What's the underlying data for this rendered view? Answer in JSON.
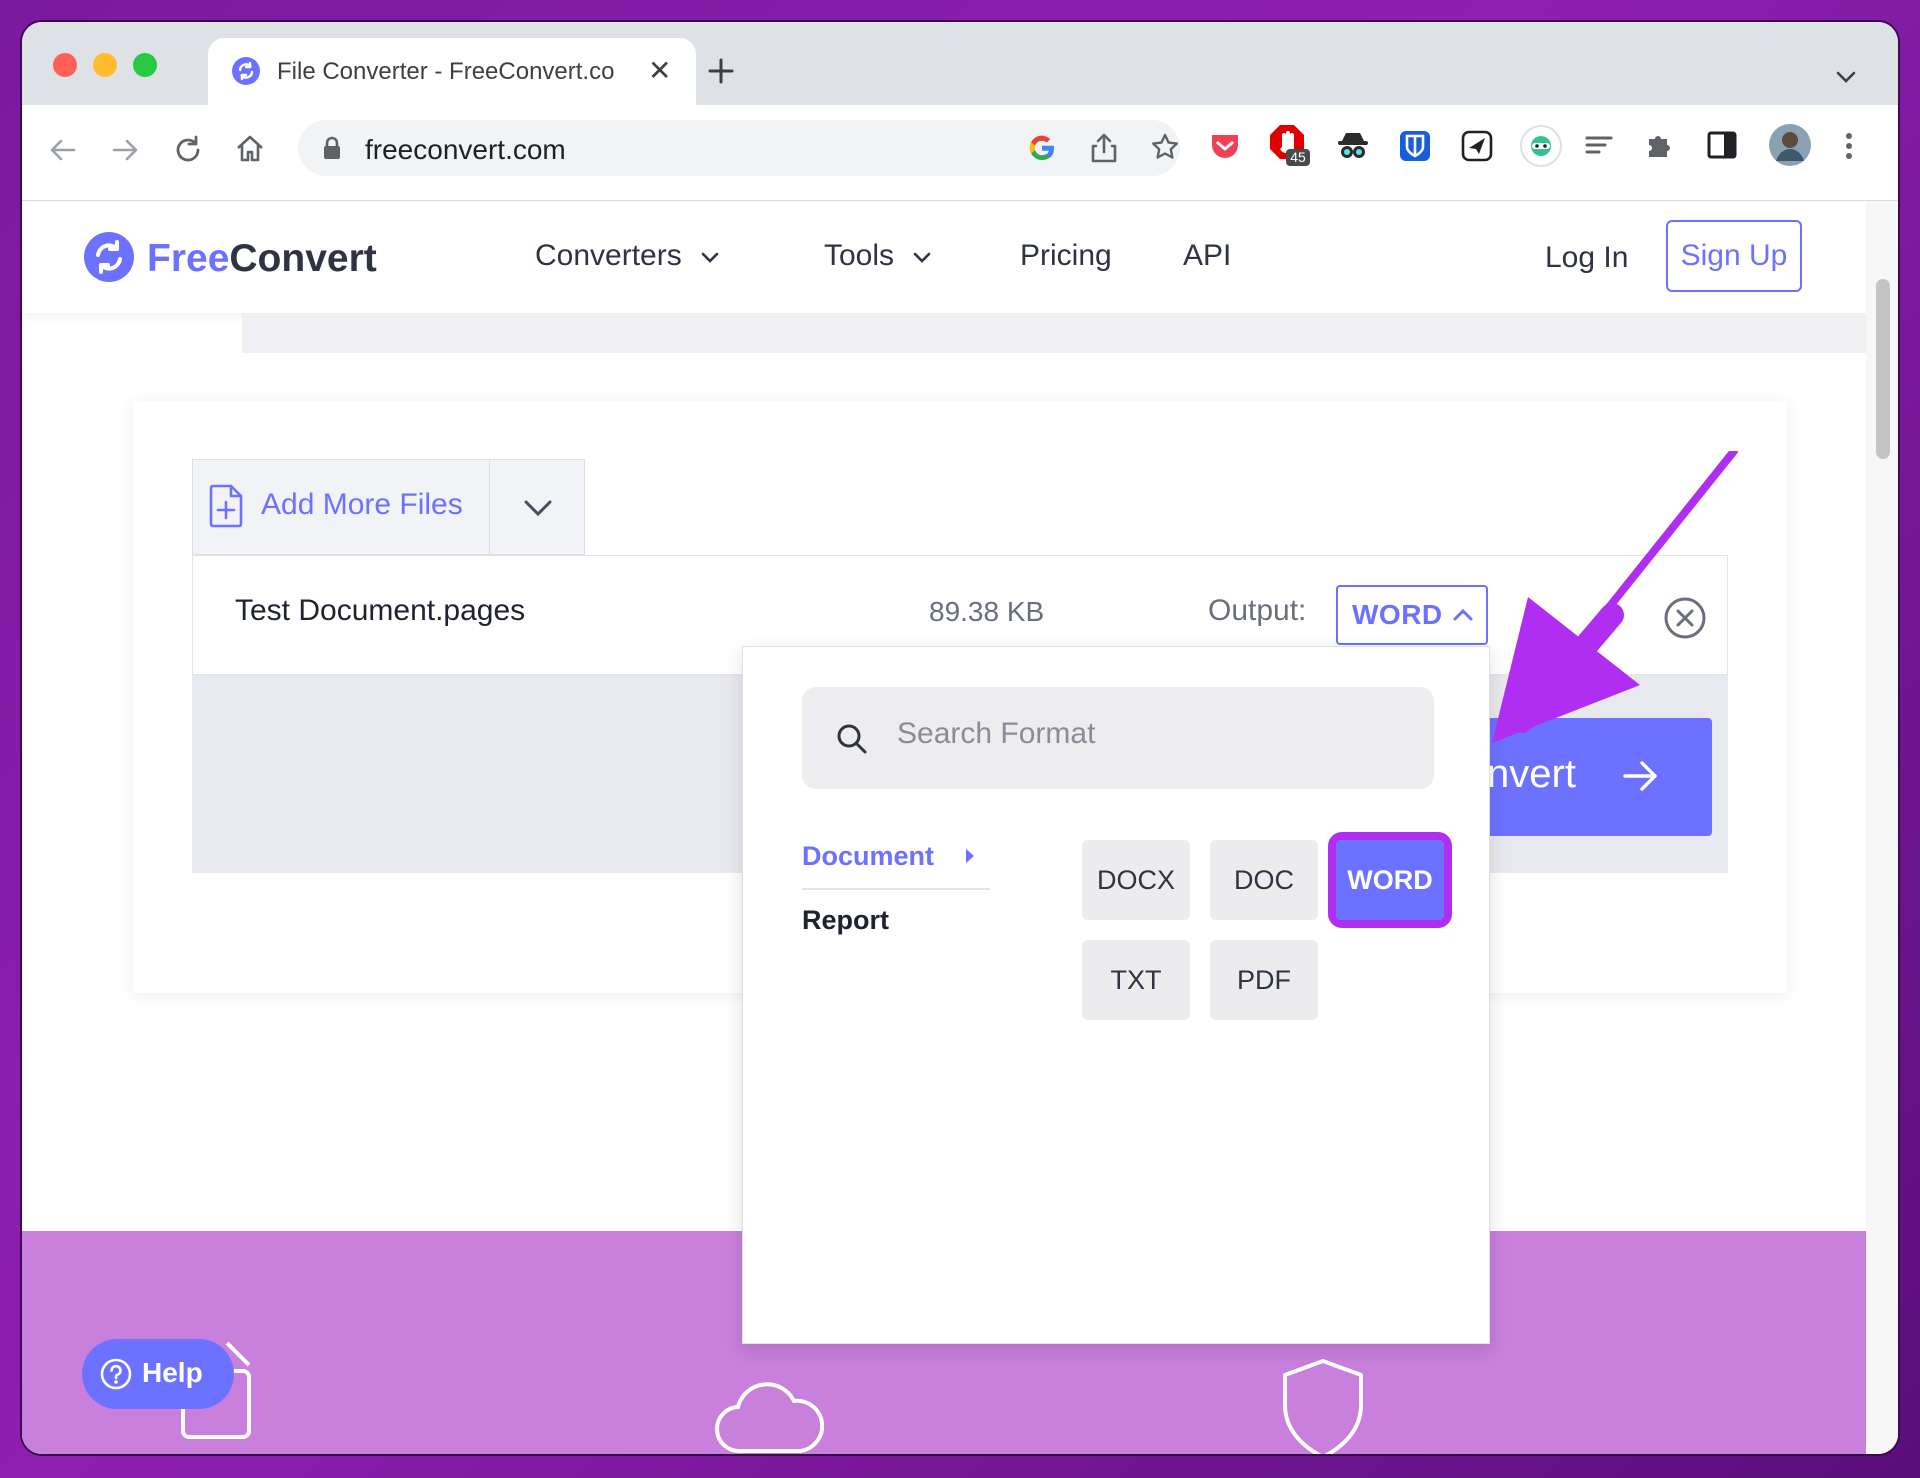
{
  "browser": {
    "tab": {
      "title": "File Converter - FreeConvert.co"
    },
    "url": "freeconvert.com",
    "extension_badge": "45"
  },
  "site": {
    "logo_free": "Free",
    "logo_convert": "Convert",
    "nav": [
      {
        "label": "Converters"
      },
      {
        "label": "Tools"
      },
      {
        "label": "Pricing"
      },
      {
        "label": "API"
      }
    ],
    "login_label": "Log In",
    "signup_label": "Sign Up"
  },
  "uploader": {
    "add_files_label": "Add More Files",
    "file": {
      "name": "Test Document.pages",
      "size": "89.38 KB",
      "output_label": "Output:",
      "output_value": "WORD"
    },
    "convert_label": "nvert"
  },
  "format_dropdown": {
    "search_placeholder": "Search Format",
    "categories": [
      {
        "label": "Document",
        "active": true
      },
      {
        "label": "Report",
        "active": false
      }
    ],
    "formats": [
      {
        "label": "DOCX",
        "selected": false
      },
      {
        "label": "DOC",
        "selected": false
      },
      {
        "label": "WORD",
        "selected": true
      },
      {
        "label": "TXT",
        "selected": false
      },
      {
        "label": "PDF",
        "selected": false
      }
    ]
  },
  "help": {
    "label": "Help"
  },
  "colors": {
    "brand": "#6c72ff",
    "annotation": "#b02ef2",
    "footer": "#c97fdc"
  }
}
